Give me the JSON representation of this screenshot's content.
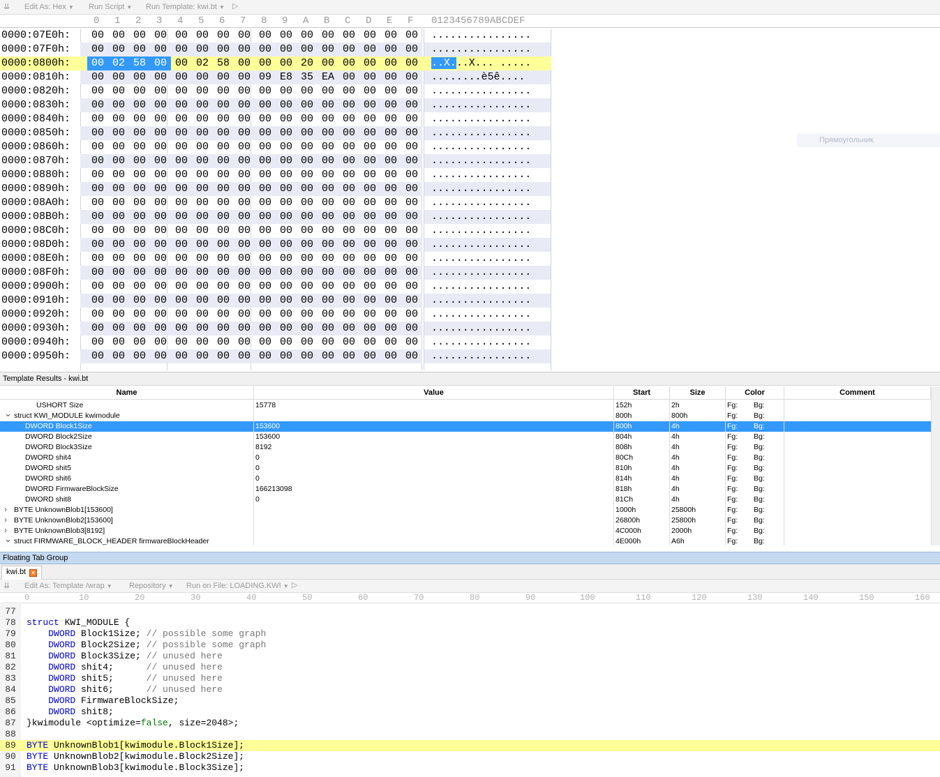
{
  "hex_toolbar": {
    "items": [
      {
        "label": "Edit As: Hex"
      },
      {
        "label": "Run Script"
      },
      {
        "label": "Run Template: kwi.bt"
      }
    ]
  },
  "hex_header": {
    "columns": [
      "0",
      "1",
      "2",
      "3",
      "4",
      "5",
      "6",
      "7",
      "8",
      "9",
      "A",
      "B",
      "C",
      "D",
      "E",
      "F"
    ],
    "ascii_header": "0123456789ABCDEF"
  },
  "hex_rows": [
    {
      "addr": "0000:07E0h:",
      "bytes": [
        "00",
        "00",
        "00",
        "00",
        "00",
        "00",
        "00",
        "00",
        "00",
        "00",
        "00",
        "00",
        "00",
        "00",
        "00",
        "00"
      ],
      "ascii": "................"
    },
    {
      "addr": "0000:07F0h:",
      "bytes": [
        "00",
        "00",
        "00",
        "00",
        "00",
        "00",
        "00",
        "00",
        "00",
        "00",
        "00",
        "00",
        "00",
        "00",
        "00",
        "00"
      ],
      "ascii": "................"
    },
    {
      "addr": "0000:0800h:",
      "bytes": [
        "00",
        "02",
        "58",
        "00",
        "00",
        "02",
        "58",
        "00",
        "00",
        "00",
        "20",
        "00",
        "00",
        "00",
        "00",
        "00"
      ],
      "ascii": "..X...X... ....."
    },
    {
      "addr": "0000:0810h:",
      "bytes": [
        "00",
        "00",
        "00",
        "00",
        "00",
        "00",
        "00",
        "00",
        "09",
        "E8",
        "35",
        "EA",
        "00",
        "00",
        "00",
        "00"
      ],
      "ascii": "........è5ê...."
    },
    {
      "addr": "0000:0820h:",
      "bytes": [
        "00",
        "00",
        "00",
        "00",
        "00",
        "00",
        "00",
        "00",
        "00",
        "00",
        "00",
        "00",
        "00",
        "00",
        "00",
        "00"
      ],
      "ascii": "................"
    },
    {
      "addr": "0000:0830h:",
      "bytes": [
        "00",
        "00",
        "00",
        "00",
        "00",
        "00",
        "00",
        "00",
        "00",
        "00",
        "00",
        "00",
        "00",
        "00",
        "00",
        "00"
      ],
      "ascii": "................"
    },
    {
      "addr": "0000:0840h:",
      "bytes": [
        "00",
        "00",
        "00",
        "00",
        "00",
        "00",
        "00",
        "00",
        "00",
        "00",
        "00",
        "00",
        "00",
        "00",
        "00",
        "00"
      ],
      "ascii": "................"
    },
    {
      "addr": "0000:0850h:",
      "bytes": [
        "00",
        "00",
        "00",
        "00",
        "00",
        "00",
        "00",
        "00",
        "00",
        "00",
        "00",
        "00",
        "00",
        "00",
        "00",
        "00"
      ],
      "ascii": "................"
    },
    {
      "addr": "0000:0860h:",
      "bytes": [
        "00",
        "00",
        "00",
        "00",
        "00",
        "00",
        "00",
        "00",
        "00",
        "00",
        "00",
        "00",
        "00",
        "00",
        "00",
        "00"
      ],
      "ascii": "................"
    },
    {
      "addr": "0000:0870h:",
      "bytes": [
        "00",
        "00",
        "00",
        "00",
        "00",
        "00",
        "00",
        "00",
        "00",
        "00",
        "00",
        "00",
        "00",
        "00",
        "00",
        "00"
      ],
      "ascii": "................"
    },
    {
      "addr": "0000:0880h:",
      "bytes": [
        "00",
        "00",
        "00",
        "00",
        "00",
        "00",
        "00",
        "00",
        "00",
        "00",
        "00",
        "00",
        "00",
        "00",
        "00",
        "00"
      ],
      "ascii": "................"
    },
    {
      "addr": "0000:0890h:",
      "bytes": [
        "00",
        "00",
        "00",
        "00",
        "00",
        "00",
        "00",
        "00",
        "00",
        "00",
        "00",
        "00",
        "00",
        "00",
        "00",
        "00"
      ],
      "ascii": "................"
    },
    {
      "addr": "0000:08A0h:",
      "bytes": [
        "00",
        "00",
        "00",
        "00",
        "00",
        "00",
        "00",
        "00",
        "00",
        "00",
        "00",
        "00",
        "00",
        "00",
        "00",
        "00"
      ],
      "ascii": "................"
    },
    {
      "addr": "0000:08B0h:",
      "bytes": [
        "00",
        "00",
        "00",
        "00",
        "00",
        "00",
        "00",
        "00",
        "00",
        "00",
        "00",
        "00",
        "00",
        "00",
        "00",
        "00"
      ],
      "ascii": "................"
    },
    {
      "addr": "0000:08C0h:",
      "bytes": [
        "00",
        "00",
        "00",
        "00",
        "00",
        "00",
        "00",
        "00",
        "00",
        "00",
        "00",
        "00",
        "00",
        "00",
        "00",
        "00"
      ],
      "ascii": "................"
    },
    {
      "addr": "0000:08D0h:",
      "bytes": [
        "00",
        "00",
        "00",
        "00",
        "00",
        "00",
        "00",
        "00",
        "00",
        "00",
        "00",
        "00",
        "00",
        "00",
        "00",
        "00"
      ],
      "ascii": "................"
    },
    {
      "addr": "0000:08E0h:",
      "bytes": [
        "00",
        "00",
        "00",
        "00",
        "00",
        "00",
        "00",
        "00",
        "00",
        "00",
        "00",
        "00",
        "00",
        "00",
        "00",
        "00"
      ],
      "ascii": "................"
    },
    {
      "addr": "0000:08F0h:",
      "bytes": [
        "00",
        "00",
        "00",
        "00",
        "00",
        "00",
        "00",
        "00",
        "00",
        "00",
        "00",
        "00",
        "00",
        "00",
        "00",
        "00"
      ],
      "ascii": "................"
    },
    {
      "addr": "0000:0900h:",
      "bytes": [
        "00",
        "00",
        "00",
        "00",
        "00",
        "00",
        "00",
        "00",
        "00",
        "00",
        "00",
        "00",
        "00",
        "00",
        "00",
        "00"
      ],
      "ascii": "................"
    },
    {
      "addr": "0000:0910h:",
      "bytes": [
        "00",
        "00",
        "00",
        "00",
        "00",
        "00",
        "00",
        "00",
        "00",
        "00",
        "00",
        "00",
        "00",
        "00",
        "00",
        "00"
      ],
      "ascii": "................"
    },
    {
      "addr": "0000:0920h:",
      "bytes": [
        "00",
        "00",
        "00",
        "00",
        "00",
        "00",
        "00",
        "00",
        "00",
        "00",
        "00",
        "00",
        "00",
        "00",
        "00",
        "00"
      ],
      "ascii": "................"
    },
    {
      "addr": "0000:0930h:",
      "bytes": [
        "00",
        "00",
        "00",
        "00",
        "00",
        "00",
        "00",
        "00",
        "00",
        "00",
        "00",
        "00",
        "00",
        "00",
        "00",
        "00"
      ],
      "ascii": "................"
    },
    {
      "addr": "0000:0940h:",
      "bytes": [
        "00",
        "00",
        "00",
        "00",
        "00",
        "00",
        "00",
        "00",
        "00",
        "00",
        "00",
        "00",
        "00",
        "00",
        "00",
        "00"
      ],
      "ascii": "................"
    },
    {
      "addr": "0000:0950h:",
      "bytes": [
        "00",
        "00",
        "00",
        "00",
        "00",
        "00",
        "00",
        "00",
        "00",
        "00",
        "00",
        "00",
        "00",
        "00",
        "00",
        "00"
      ],
      "ascii": "................"
    }
  ],
  "hex_selection": {
    "row": 2,
    "byte_start": 0,
    "byte_end": 3,
    "ascii_selected": "..X."
  },
  "ghost_label": "Прямоугольник",
  "template_results": {
    "title": "Template Results - kwi.bt",
    "columns": [
      "Name",
      "Value",
      "Start",
      "Size",
      "Color",
      "Comment"
    ],
    "rows": [
      {
        "name": "USHORT Size",
        "value": "15778",
        "start": "152h",
        "size": "2h",
        "fg": "Fg:",
        "bg": "Bg:",
        "indent": 2,
        "arrow": ""
      },
      {
        "name": "struct KWI_MODULE kwimodule",
        "value": "",
        "start": "800h",
        "size": "800h",
        "fg": "Fg:",
        "bg": "Bg:",
        "indent": 1,
        "arrow": "down"
      },
      {
        "name": "DWORD Block1Size",
        "value": "153600",
        "start": "800h",
        "size": "4h",
        "fg": "Fg:",
        "bg": "Bg:",
        "indent": 2,
        "arrow": "",
        "selected": true
      },
      {
        "name": "DWORD Block2Size",
        "value": "153600",
        "start": "804h",
        "size": "4h",
        "fg": "Fg:",
        "bg": "Bg:",
        "indent": 2,
        "arrow": ""
      },
      {
        "name": "DWORD Block3Size",
        "value": "8192",
        "start": "808h",
        "size": "4h",
        "fg": "Fg:",
        "bg": "Bg:",
        "indent": 2,
        "arrow": ""
      },
      {
        "name": "DWORD shit4",
        "value": "0",
        "start": "80Ch",
        "size": "4h",
        "fg": "Fg:",
        "bg": "Bg:",
        "indent": 2,
        "arrow": ""
      },
      {
        "name": "DWORD shit5",
        "value": "0",
        "start": "810h",
        "size": "4h",
        "fg": "Fg:",
        "bg": "Bg:",
        "indent": 2,
        "arrow": ""
      },
      {
        "name": "DWORD shit6",
        "value": "0",
        "start": "814h",
        "size": "4h",
        "fg": "Fg:",
        "bg": "Bg:",
        "indent": 2,
        "arrow": ""
      },
      {
        "name": "DWORD FirmwareBlockSize",
        "value": "166213098",
        "start": "818h",
        "size": "4h",
        "fg": "Fg:",
        "bg": "Bg:",
        "indent": 2,
        "arrow": ""
      },
      {
        "name": "DWORD shit8",
        "value": "0",
        "start": "81Ch",
        "size": "4h",
        "fg": "Fg:",
        "bg": "Bg:",
        "indent": 2,
        "arrow": ""
      },
      {
        "name": "BYTE UnknownBlob1[153600]",
        "value": "",
        "start": "1000h",
        "size": "25800h",
        "fg": "Fg:",
        "bg": "Bg:",
        "indent": 1,
        "arrow": "right"
      },
      {
        "name": "BYTE UnknownBlob2[153600]",
        "value": "",
        "start": "26800h",
        "size": "25800h",
        "fg": "Fg:",
        "bg": "Bg:",
        "indent": 1,
        "arrow": "right"
      },
      {
        "name": "BYTE UnknownBlob3[8192]",
        "value": "",
        "start": "4C000h",
        "size": "2000h",
        "fg": "Fg:",
        "bg": "Bg:",
        "indent": 1,
        "arrow": "right"
      },
      {
        "name": "struct FIRMWARE_BLOCK_HEADER firmwareBlockHeader",
        "value": "",
        "start": "4E000h",
        "size": "A6h",
        "fg": "Fg:",
        "bg": "Bg:",
        "indent": 1,
        "arrow": "down"
      }
    ]
  },
  "floating_tab_group": {
    "title": "Floating Tab Group",
    "tab_label": "kwi.bt"
  },
  "editor_toolbar": {
    "items": [
      {
        "label": "Edit As: Template /wrap"
      },
      {
        "label": "Repository"
      },
      {
        "label": "Run on File: LOADING.KWI"
      }
    ]
  },
  "ruler": [
    "0",
    "10",
    "20",
    "30",
    "40",
    "50",
    "60",
    "70",
    "80",
    "90",
    "100",
    "110",
    "120",
    "130",
    "140",
    "150",
    "160"
  ],
  "editor": {
    "highlight_line": 89,
    "lines": [
      {
        "num": "77",
        "tokens": []
      },
      {
        "num": "78",
        "tokens": [
          {
            "t": "kw",
            "s": "struct"
          },
          {
            "t": "",
            "s": " KWI_MODULE {"
          }
        ]
      },
      {
        "num": "79",
        "tokens": [
          {
            "t": "",
            "s": "    "
          },
          {
            "t": "kw",
            "s": "DWORD"
          },
          {
            "t": "",
            "s": " Block1Size; "
          },
          {
            "t": "cm",
            "s": "// possible some graph"
          }
        ]
      },
      {
        "num": "80",
        "tokens": [
          {
            "t": "",
            "s": "    "
          },
          {
            "t": "kw",
            "s": "DWORD"
          },
          {
            "t": "",
            "s": " Block2Size; "
          },
          {
            "t": "cm",
            "s": "// possible some graph"
          }
        ]
      },
      {
        "num": "81",
        "tokens": [
          {
            "t": "",
            "s": "    "
          },
          {
            "t": "kw",
            "s": "DWORD"
          },
          {
            "t": "",
            "s": " Block3Size; "
          },
          {
            "t": "cm",
            "s": "// unused here"
          }
        ]
      },
      {
        "num": "82",
        "tokens": [
          {
            "t": "",
            "s": "    "
          },
          {
            "t": "kw",
            "s": "DWORD"
          },
          {
            "t": "",
            "s": " shit4;      "
          },
          {
            "t": "cm",
            "s": "// unused here"
          }
        ]
      },
      {
        "num": "83",
        "tokens": [
          {
            "t": "",
            "s": "    "
          },
          {
            "t": "kw",
            "s": "DWORD"
          },
          {
            "t": "",
            "s": " shit5;      "
          },
          {
            "t": "cm",
            "s": "// unused here"
          }
        ]
      },
      {
        "num": "84",
        "tokens": [
          {
            "t": "",
            "s": "    "
          },
          {
            "t": "kw",
            "s": "DWORD"
          },
          {
            "t": "",
            "s": " shit6;      "
          },
          {
            "t": "cm",
            "s": "// unused here"
          }
        ]
      },
      {
        "num": "85",
        "tokens": [
          {
            "t": "",
            "s": "    "
          },
          {
            "t": "kw",
            "s": "DWORD"
          },
          {
            "t": "",
            "s": " FirmwareBlockSize;"
          }
        ]
      },
      {
        "num": "86",
        "tokens": [
          {
            "t": "",
            "s": "    "
          },
          {
            "t": "kw",
            "s": "DWORD"
          },
          {
            "t": "",
            "s": " shit8;"
          }
        ]
      },
      {
        "num": "87",
        "tokens": [
          {
            "t": "",
            "s": "}kwimodule <optimize="
          },
          {
            "t": "gr",
            "s": "false"
          },
          {
            "t": "",
            "s": ", size=2048>;"
          }
        ]
      },
      {
        "num": "88",
        "tokens": []
      },
      {
        "num": "89",
        "tokens": [
          {
            "t": "kw",
            "s": "BYTE"
          },
          {
            "t": "",
            "s": " UnknownBlob1[kwimodule.Block1Size];"
          }
        ]
      },
      {
        "num": "90",
        "tokens": [
          {
            "t": "kw",
            "s": "BYTE"
          },
          {
            "t": "",
            "s": " UnknownBlob2[kwimodule.Block2Size];"
          }
        ]
      },
      {
        "num": "91",
        "tokens": [
          {
            "t": "kw",
            "s": "BYTE"
          },
          {
            "t": "",
            "s": " UnknownBlob3[kwimodule.Block3Size];"
          }
        ]
      }
    ]
  },
  "colors": {
    "selection": "#3399ff",
    "highlight": "#ffff99",
    "row_band": "#e8ebf5",
    "keyword": "#0000cc",
    "comment": "#777777",
    "boolean": "#007a00",
    "tab_group": "#c5d9f1",
    "close_button": "#f08030"
  }
}
